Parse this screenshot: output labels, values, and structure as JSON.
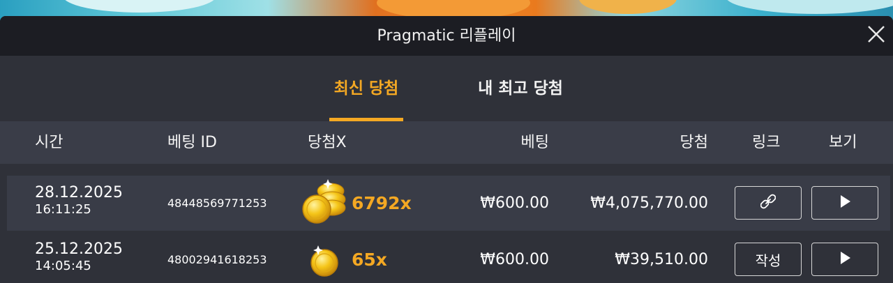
{
  "dialog": {
    "title": "Pragmatic 리플레이",
    "close_icon": "close-icon"
  },
  "tabs": [
    {
      "label": "최신 당첨",
      "active": true
    },
    {
      "label": "내 최고 당첨",
      "active": false
    }
  ],
  "table": {
    "headers": {
      "time": "시간",
      "bet_id": "베팅 ID",
      "win_x": "당첨X",
      "bet": "베팅",
      "win": "당첨",
      "link": "링크",
      "view": "보기"
    },
    "rows": [
      {
        "date": "28.12.2025",
        "time": "16:11:25",
        "bet_id": "48448569771253",
        "multiplier": "6792x",
        "coin_icon": "coin-stack-icon",
        "bet": "₩600.00",
        "win": "₩4,075,770.00",
        "link_type": "icon",
        "link_icon": "link-icon",
        "play_icon": "play-icon"
      },
      {
        "date": "25.12.2025",
        "time": "14:05:45",
        "bet_id": "48002941618253",
        "multiplier": "65x",
        "coin_icon": "coin-icon",
        "bet": "₩600.00",
        "win": "₩39,510.00",
        "link_type": "text",
        "link_label": "작성",
        "play_icon": "play-icon"
      }
    ]
  },
  "colors": {
    "accent": "#f4a823",
    "title_bar": "#1c1d23",
    "panel": "#2f3139",
    "header_row": "#3a3d48"
  }
}
